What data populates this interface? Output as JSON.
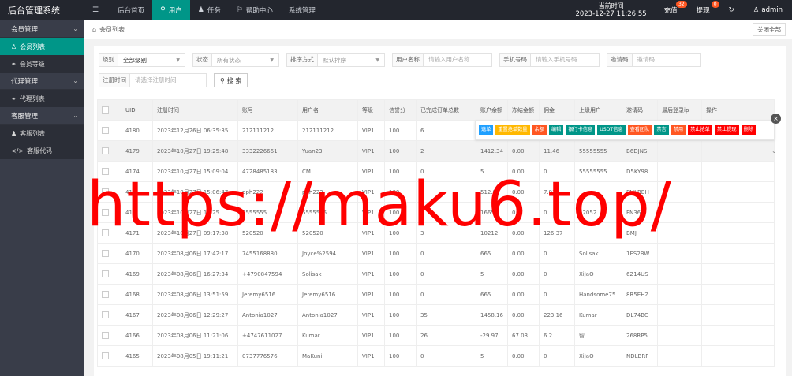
{
  "brand": "后台管理系统",
  "topnav": [
    {
      "icon": "☰",
      "label": ""
    },
    {
      "icon": "",
      "label": "后台首页"
    },
    {
      "icon": "⚲",
      "label": "用户"
    },
    {
      "icon": "♟",
      "label": "任务"
    },
    {
      "icon": "⚐",
      "label": "帮助中心"
    },
    {
      "icon": "",
      "label": "系统管理"
    }
  ],
  "clock": {
    "label": "当前时间",
    "time": "2023-12-27 11:26:55"
  },
  "topright": {
    "recharge": "充值",
    "recharge_badge": "32",
    "withdraw": "提现",
    "withdraw_badge": "0",
    "refresh_icon": "↻",
    "admin": "admin"
  },
  "sidebar": [
    {
      "type": "group",
      "label": "会员管理"
    },
    {
      "type": "item",
      "label": "会员列表",
      "icon": "♙",
      "active": true
    },
    {
      "type": "item",
      "label": "会员等级",
      "icon": "⚭"
    },
    {
      "type": "group",
      "label": "代理管理"
    },
    {
      "type": "item",
      "label": "代理列表",
      "icon": "⚭"
    },
    {
      "type": "group",
      "label": "客服管理"
    },
    {
      "type": "item",
      "label": "客服列表",
      "icon": "♟"
    },
    {
      "type": "item",
      "label": "客服代码",
      "icon": "</>"
    }
  ],
  "tabs": {
    "current": "会员列表",
    "close_all": "关闭全部"
  },
  "filters": {
    "level_label": "级别",
    "level_value": "全部级别",
    "status_label": "状态",
    "status_placeholder": "所有状态",
    "sort_label": "排序方式",
    "sort_placeholder": "默认排序",
    "username_label": "用户名称",
    "username_placeholder": "请输入用户名称",
    "phone_label": "手机号码",
    "phone_placeholder": "请输入手机号码",
    "invite_label": "邀请码",
    "invite_placeholder": "邀请码",
    "regtime_label": "注册时间",
    "regtime_placeholder": "请选择注册时间",
    "search": "搜 索"
  },
  "table": {
    "headers": [
      "",
      "UID",
      "注册时间",
      "账号",
      "用户名",
      "等级",
      "信誉分",
      "已完成订单总数",
      "账户余额",
      "冻结金额",
      "佣金",
      "上级用户",
      "邀请码",
      "最后登录ip",
      "操作"
    ],
    "rows": [
      [
        "4180",
        "2023年12月26日 06:35:35",
        "212111212",
        "212111212",
        "VIP1",
        "100",
        "6",
        "",
        "",
        "",
        "",
        "",
        "",
        ""
      ],
      [
        "4179",
        "2023年10月27日 19:25:48",
        "3332226661",
        "Yuan23",
        "VIP1",
        "100",
        "2",
        "1412.34",
        "0.00",
        "11.46",
        "55555555",
        "B6DJNS",
        "",
        ""
      ],
      [
        "4174",
        "2023年10月27日 15:09:04",
        "4728485183",
        "CM",
        "VIP1",
        "100",
        "0",
        "5",
        "0.00",
        "0",
        "55555555",
        "D5KY98",
        "",
        ""
      ],
      [
        "417",
        "2023年10月27日 15:06:47",
        "pph222",
        "pph222",
        "VIP1",
        "100",
        "4",
        "512.93",
        "0.00",
        "7.93",
        "",
        "FMLBBH",
        "",
        ""
      ],
      [
        "417",
        "2023年10月27日 10:25",
        "5555555",
        "5555555",
        "VIP1",
        "100",
        "0",
        "1665",
        "0",
        "0",
        "52052",
        "FN36D",
        "",
        ""
      ],
      [
        "4171",
        "2023年10月27日 09:17:38",
        "520520",
        "520520",
        "VIP1",
        "100",
        "3",
        "10212",
        "0.00",
        "126.37",
        "",
        "BMJ",
        "",
        ""
      ],
      [
        "4170",
        "2023年08月06日 17:42:17",
        "7455168880",
        "Joyce%2594",
        "VIP1",
        "100",
        "0",
        "665",
        "0.00",
        "0",
        "Solisak",
        "1ES2BW",
        "",
        ""
      ],
      [
        "4169",
        "2023年08月06日 16:27:34",
        "+4790847594",
        "Solisak",
        "VIP1",
        "100",
        "0",
        "5",
        "0.00",
        "0",
        "XiJaO",
        "6Z14US",
        "",
        ""
      ],
      [
        "4168",
        "2023年08月06日 13:51:59",
        "Jeremy6516",
        "Jeremy6516",
        "VIP1",
        "100",
        "0",
        "665",
        "0.00",
        "0",
        "Handsome75",
        "8R5EHZ",
        "",
        ""
      ],
      [
        "4167",
        "2023年08月06日 12:29:27",
        "Antonia1027",
        "Antonia1027",
        "VIP1",
        "100",
        "35",
        "1458.16",
        "0.00",
        "223.16",
        "Kumar",
        "DL74BG",
        "",
        ""
      ],
      [
        "4166",
        "2023年08月06日 11:21:06",
        "+4747611027",
        "Kumar",
        "VIP1",
        "100",
        "26",
        "-29.97",
        "67.03",
        "6.2",
        "智",
        "268RP5",
        "",
        ""
      ],
      [
        "4165",
        "2023年08月05日 19:11:21",
        "0737776576",
        "MaKuni",
        "VIP1",
        "100",
        "0",
        "5",
        "0.00",
        "0",
        "XiJaO",
        "NDLBRF",
        "",
        ""
      ]
    ],
    "select_btn": "选择",
    "more": "..."
  },
  "popup": {
    "buttons": [
      {
        "label": "选单",
        "color": "#1e9fff"
      },
      {
        "label": "重置抢单数量",
        "color": "#ffb800"
      },
      {
        "label": "余额",
        "color": "#ff5722"
      },
      {
        "label": "编辑",
        "color": "#009688"
      },
      {
        "label": "银行卡信息",
        "color": "#009688"
      },
      {
        "label": "USDT信息",
        "color": "#009688"
      },
      {
        "label": "查看团队",
        "color": "#ff5722"
      },
      {
        "label": "禁言",
        "color": "#009688"
      },
      {
        "label": "禁用",
        "color": "#ff5722"
      },
      {
        "label": "禁止抢单",
        "color": "#ff0000"
      },
      {
        "label": "禁止提现",
        "color": "#ff0000"
      },
      {
        "label": "删除",
        "color": "#ff0000"
      }
    ],
    "close": "×"
  },
  "watermark": "https://maku6.top/"
}
